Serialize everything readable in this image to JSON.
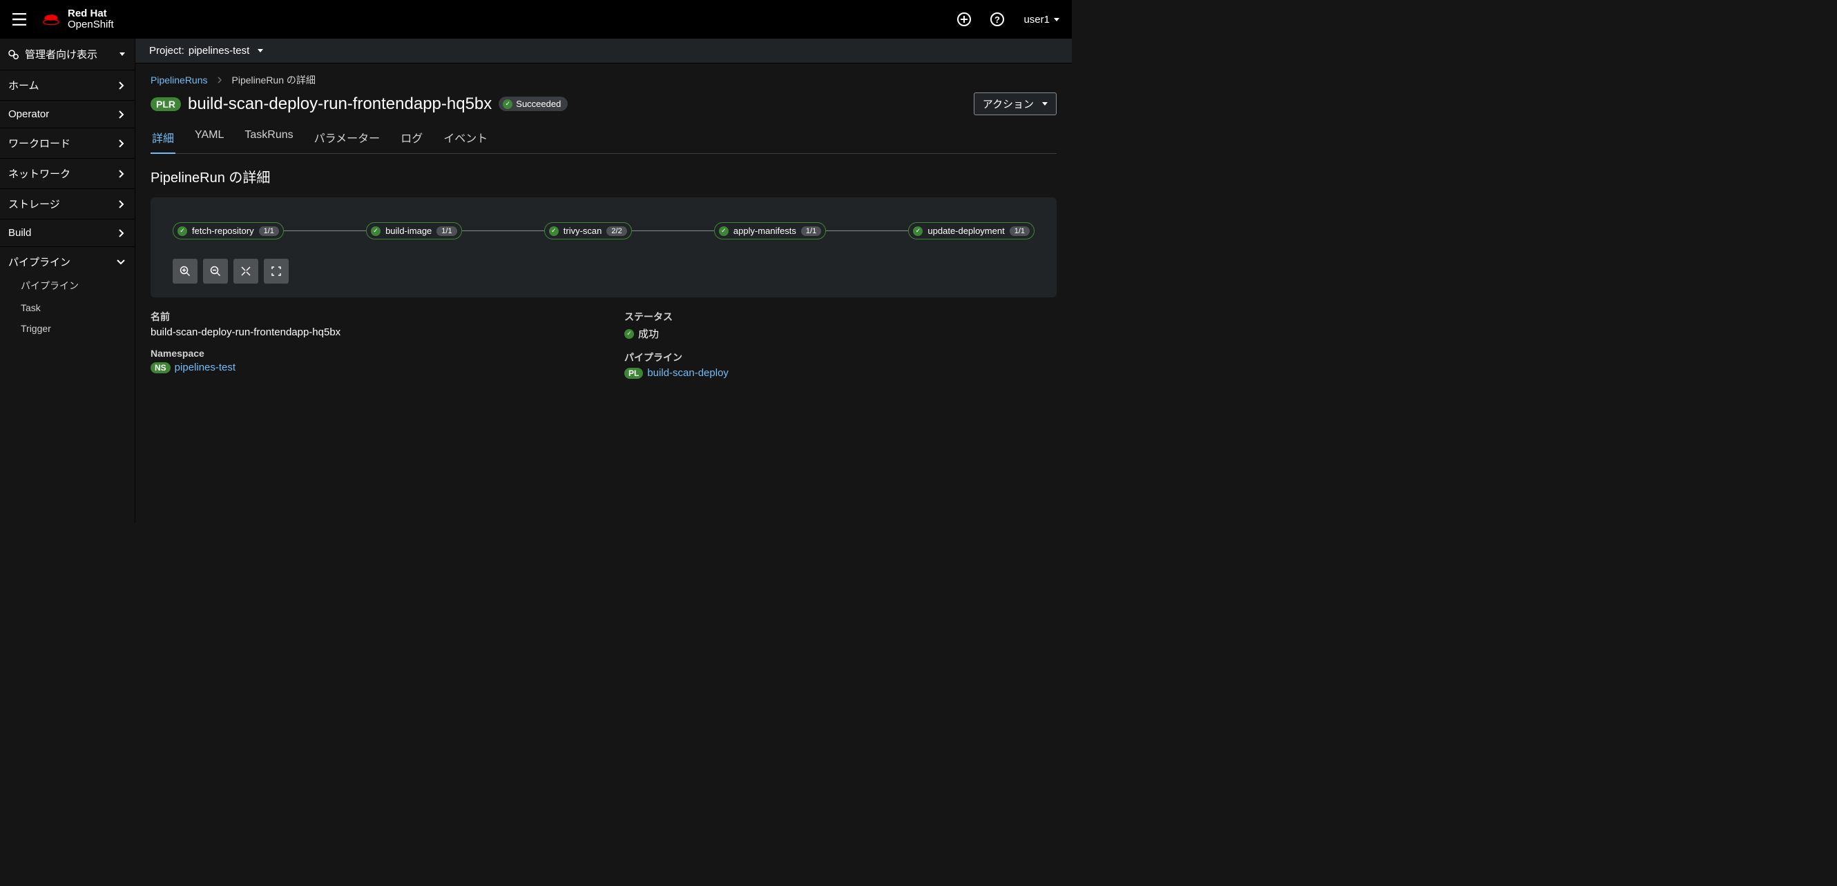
{
  "header": {
    "brand_line1": "Red Hat",
    "brand_line2": "OpenShift",
    "user": "user1"
  },
  "sidebar": {
    "perspective": "管理者向け表示",
    "items": [
      {
        "label": "ホーム",
        "expanded": false
      },
      {
        "label": "Operator",
        "expanded": false
      },
      {
        "label": "ワークロード",
        "expanded": false
      },
      {
        "label": "ネットワーク",
        "expanded": false
      },
      {
        "label": "ストレージ",
        "expanded": false
      },
      {
        "label": "Build",
        "expanded": false
      },
      {
        "label": "パイプライン",
        "expanded": true
      }
    ],
    "pipeline_subs": [
      "パイプライン",
      "Task",
      "Trigger"
    ]
  },
  "project": {
    "prefix": "Project:",
    "name": "pipelines-test"
  },
  "breadcrumb": {
    "root": "PipelineRuns",
    "current": "PipelineRun の詳細"
  },
  "title": {
    "badge": "PLR",
    "name": "build-scan-deploy-run-frontendapp-hq5bx",
    "status": "Succeeded"
  },
  "actions_label": "アクション",
  "tabs": [
    "詳細",
    "YAML",
    "TaskRuns",
    "パラメーター",
    "ログ",
    "イベント"
  ],
  "active_tab": 0,
  "section_title": "PipelineRun の詳細",
  "pipeline_tasks": [
    {
      "name": "fetch-repository",
      "count": "1/1"
    },
    {
      "name": "build-image",
      "count": "1/1"
    },
    {
      "name": "trivy-scan",
      "count": "2/2"
    },
    {
      "name": "apply-manifests",
      "count": "1/1"
    },
    {
      "name": "update-deployment",
      "count": "1/1"
    }
  ],
  "details": {
    "name_label": "名前",
    "name_value": "build-scan-deploy-run-frontendapp-hq5bx",
    "namespace_label": "Namespace",
    "namespace_badge": "NS",
    "namespace_value": "pipelines-test",
    "status_label": "ステータス",
    "status_value": "成功",
    "pipeline_label": "パイプライン",
    "pipeline_badge": "PL",
    "pipeline_value": "build-scan-deploy"
  }
}
